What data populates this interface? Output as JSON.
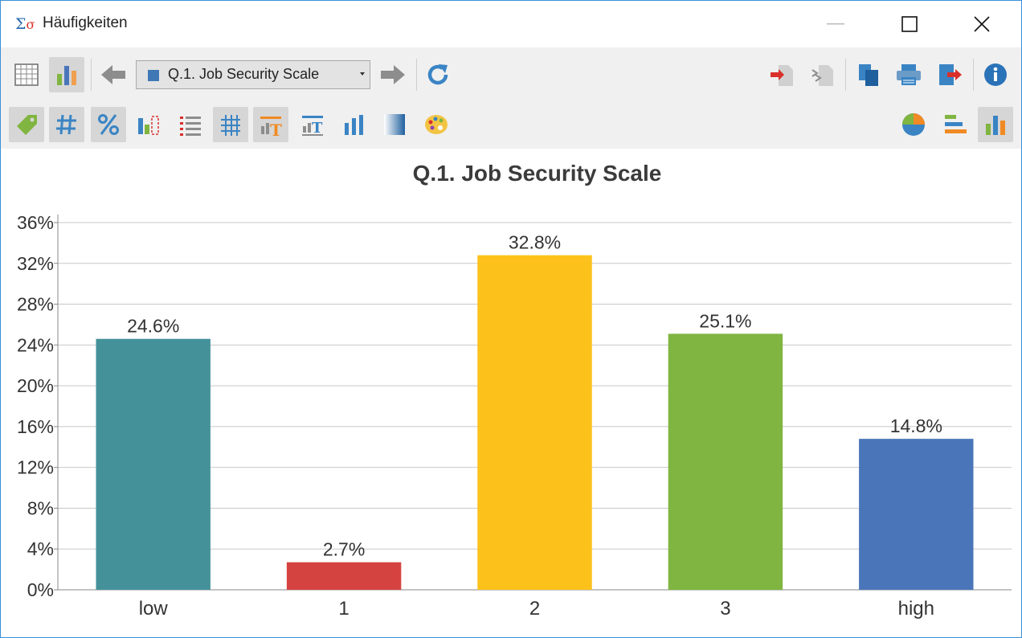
{
  "window": {
    "title": "Häufigkeiten",
    "icon": "sigma-icon"
  },
  "toolbar": {
    "variable_selector": "Q.1. Job Security Scale",
    "variable_color": "#3f78b5"
  },
  "chart_data": {
    "type": "bar",
    "title": "Q.1. Job Security Scale",
    "categories": [
      "low",
      "1",
      "2",
      "3",
      "high"
    ],
    "values": [
      24.6,
      2.7,
      32.8,
      25.1,
      14.8
    ],
    "value_labels": [
      "24.6%",
      "2.7%",
      "32.8%",
      "25.1%",
      "14.8%"
    ],
    "colors": [
      "#45919a",
      "#d54340",
      "#fcc21b",
      "#80b541",
      "#4a76b9"
    ],
    "ylim": [
      0,
      36
    ],
    "yticks": [
      0,
      4,
      8,
      12,
      16,
      20,
      24,
      28,
      32,
      36
    ],
    "ytick_labels": [
      "0%",
      "4%",
      "8%",
      "12%",
      "16%",
      "20%",
      "24%",
      "28%",
      "32%",
      "36%"
    ],
    "grid": true,
    "xlabel": "",
    "ylabel": ""
  }
}
